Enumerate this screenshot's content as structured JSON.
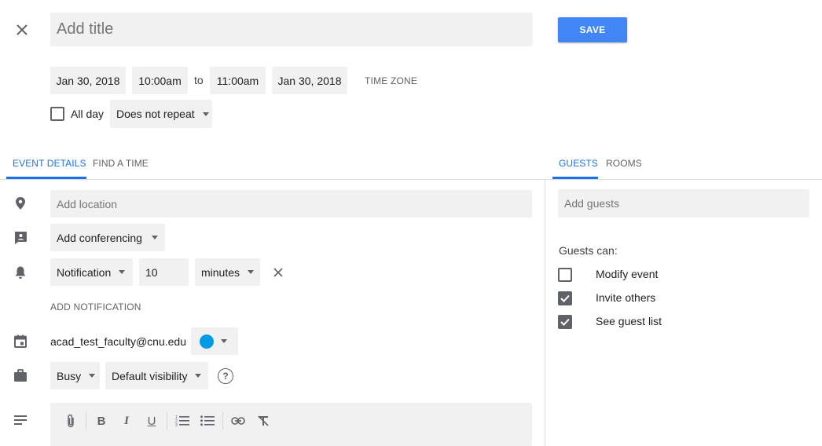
{
  "header": {
    "title_placeholder": "Add title",
    "save_label": "SAVE"
  },
  "datetime": {
    "start_date": "Jan 30, 2018",
    "start_time": "10:00am",
    "to_label": "to",
    "end_time": "11:00am",
    "end_date": "Jan 30, 2018",
    "timezone_label": "TIME ZONE",
    "all_day_label": "All day",
    "all_day_checked": false,
    "repeat_value": "Does not repeat"
  },
  "tabs_left": [
    {
      "label": "EVENT DETAILS",
      "active": true
    },
    {
      "label": "FIND A TIME",
      "active": false
    }
  ],
  "tabs_right": [
    {
      "label": "GUESTS",
      "active": true
    },
    {
      "label": "ROOMS",
      "active": false
    }
  ],
  "details": {
    "location_placeholder": "Add location",
    "conferencing_label": "Add conferencing",
    "notification_type": "Notification",
    "notification_amount": "10",
    "notification_unit": "minutes",
    "add_notification_label": "ADD NOTIFICATION",
    "calendar_owner": "acad_test_faculty@cnu.edu",
    "calendar_color": "#039be5",
    "availability": "Busy",
    "visibility": "Default visibility"
  },
  "guests": {
    "add_placeholder": "Add guests",
    "permissions_heading": "Guests can:",
    "permissions": [
      {
        "label": "Modify event",
        "checked": false
      },
      {
        "label": "Invite others",
        "checked": true
      },
      {
        "label": "See guest list",
        "checked": true
      }
    ]
  },
  "colors": {
    "accent": "#1a73e8",
    "save_button": "#4285f4"
  }
}
